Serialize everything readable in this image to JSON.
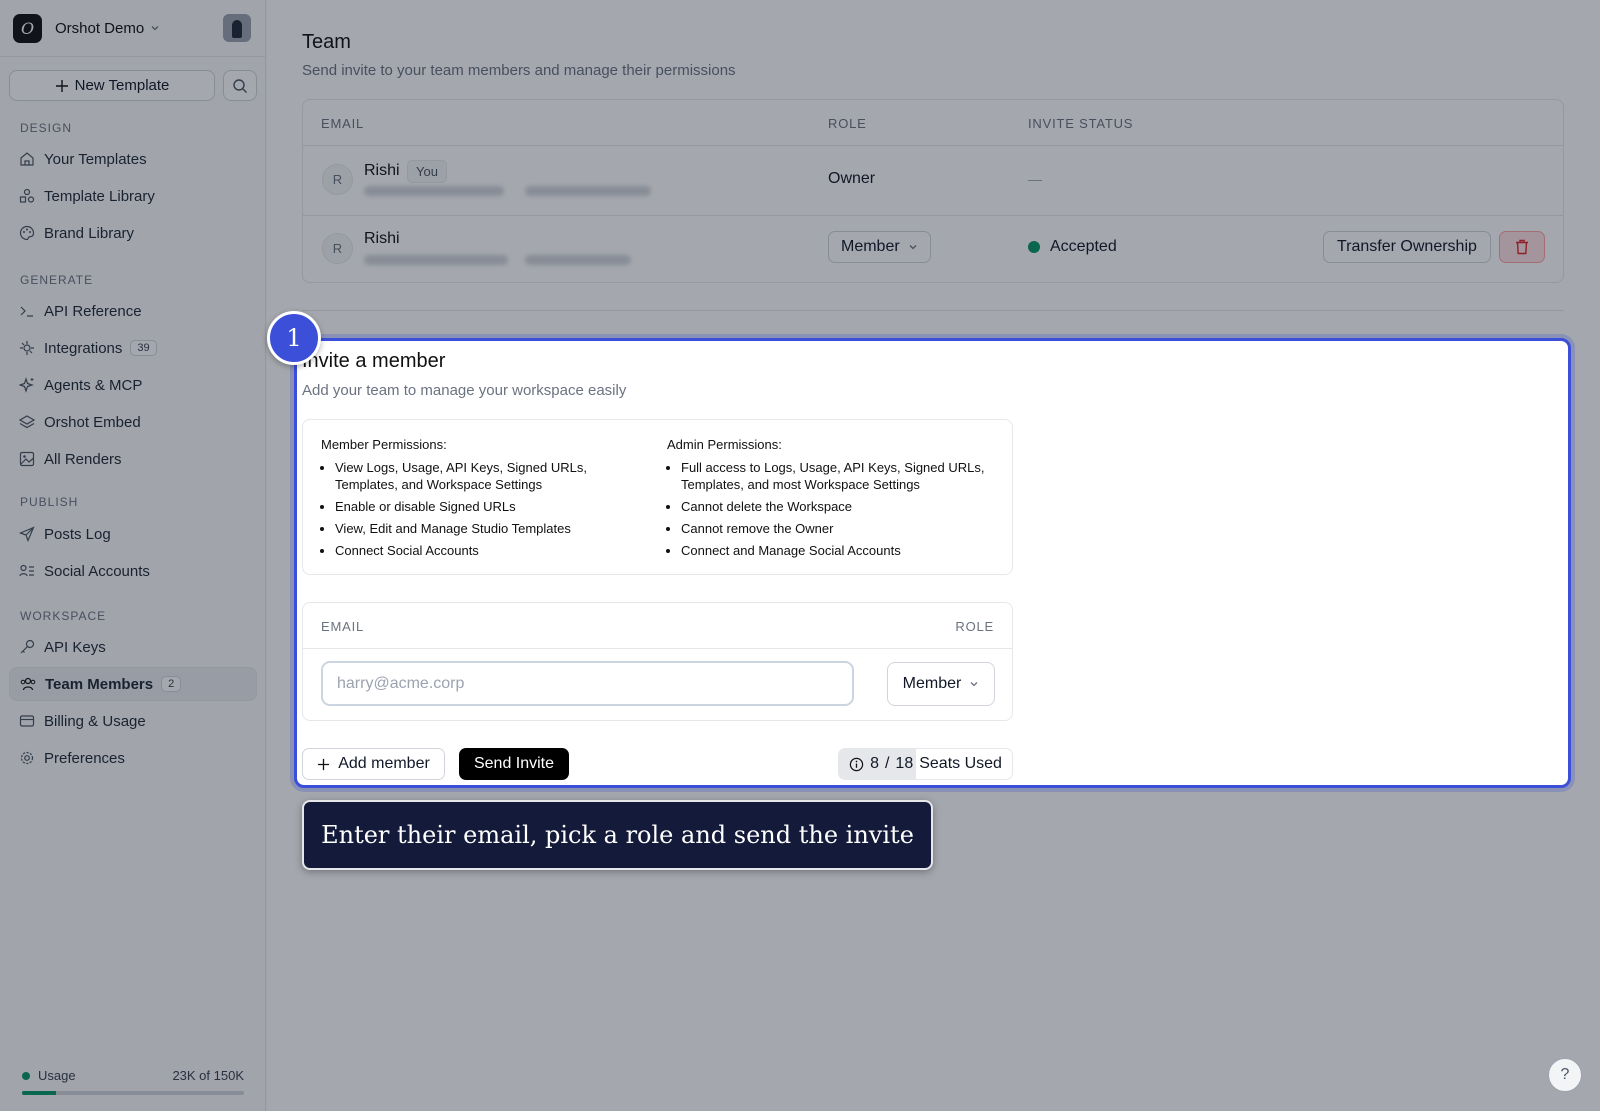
{
  "workspace": {
    "logo_letter": "O",
    "name": "Orshot Demo"
  },
  "sidebar": {
    "new_template_label": "New Template",
    "sections": {
      "design": "DESIGN",
      "generate": "GENERATE",
      "publish": "PUBLISH",
      "workspace": "WORKSPACE"
    },
    "items": [
      {
        "label": "Your Templates",
        "icon": "home-icon"
      },
      {
        "label": "Template Library",
        "icon": "shapes-icon"
      },
      {
        "label": "Brand Library",
        "icon": "palette-icon"
      },
      {
        "label": "API Reference",
        "icon": "terminal-icon"
      },
      {
        "label": "Integrations",
        "icon": "plug-icon",
        "badge": "39"
      },
      {
        "label": "Agents & MCP",
        "icon": "sparkles-icon"
      },
      {
        "label": "Orshot Embed",
        "icon": "layers-icon"
      },
      {
        "label": "All Renders",
        "icon": "image-icon"
      },
      {
        "label": "Posts Log",
        "icon": "send-icon"
      },
      {
        "label": "Social Accounts",
        "icon": "user-list-icon"
      },
      {
        "label": "API Keys",
        "icon": "key-icon"
      },
      {
        "label": "Team Members",
        "icon": "users-icon",
        "badge": "2",
        "active": true
      },
      {
        "label": "Billing & Usage",
        "icon": "credit-card-icon"
      },
      {
        "label": "Preferences",
        "icon": "gear-icon"
      }
    ],
    "usage": {
      "label": "Usage",
      "amount": "23K of 150K",
      "fraction": 0.153
    }
  },
  "team": {
    "title": "Team",
    "subtitle": "Send invite to your team members and manage their permissions",
    "columns": {
      "email": "EMAIL",
      "role": "ROLE",
      "status": "INVITE STATUS"
    },
    "members": [
      {
        "initial": "R",
        "name": "Rishi",
        "you_badge": "You",
        "role": "Owner",
        "status": "—"
      },
      {
        "initial": "R",
        "name": "Rishi",
        "role": "Member",
        "status": "Accepted",
        "transfer_label": "Transfer Ownership"
      }
    ]
  },
  "invite": {
    "step_number": "1",
    "title": "Invite a member",
    "subtitle": "Add your team to manage your workspace easily",
    "member_permissions": {
      "title": "Member Permissions:",
      "items": [
        "View Logs, Usage, API Keys, Signed URLs, Templates, and Workspace Settings",
        "Enable or disable Signed URLs",
        "View, Edit and Manage Studio Templates",
        "Connect Social Accounts"
      ]
    },
    "admin_permissions": {
      "title": "Admin Permissions:",
      "items": [
        "Full access to Logs, Usage, API Keys, Signed URLs, Templates, and most Workspace Settings",
        "Cannot delete the Workspace",
        "Cannot remove the Owner",
        "Connect and Manage Social Accounts"
      ]
    },
    "email_header": "EMAIL",
    "role_header": "ROLE",
    "email_placeholder": "harry@acme.corp",
    "role_value": "Member",
    "add_member_label": "Add member",
    "send_invite_label": "Send Invite",
    "seats": {
      "used": "8",
      "separator": "/",
      "total": "18",
      "label": "Seats Used",
      "fraction": 0.444
    }
  },
  "tooltip": {
    "text": "Enter their email, pick a role and send the invite"
  },
  "help": {
    "label": "?"
  },
  "colors": {
    "accent": "#3b4fd8",
    "success": "#059669",
    "tooltip_bg": "#141a3a"
  }
}
